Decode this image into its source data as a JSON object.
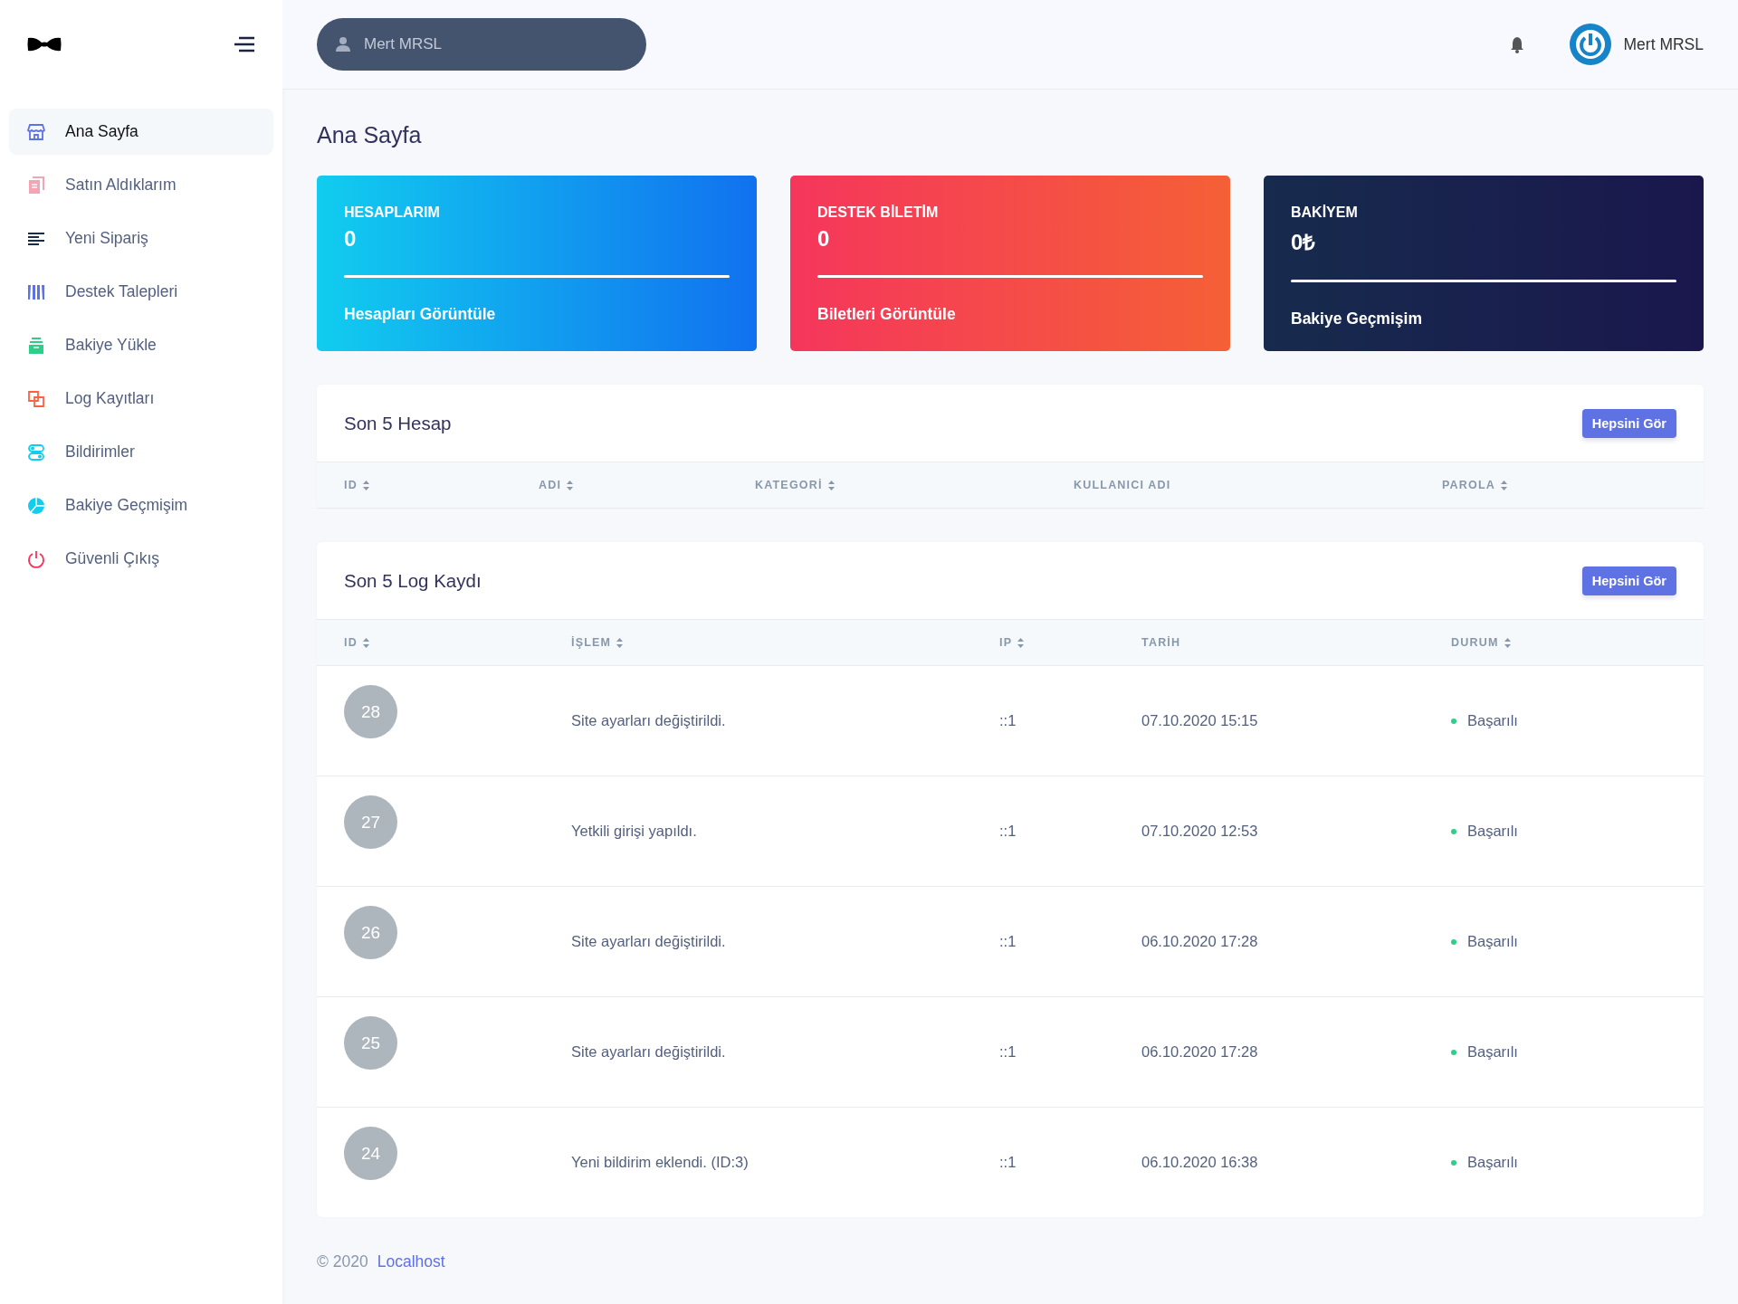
{
  "sidebar": {
    "items": [
      {
        "label": "Ana Sayfa",
        "kind": "store",
        "selected": true
      },
      {
        "label": "Satın Aldıklarım",
        "kind": "copies",
        "selected": false
      },
      {
        "label": "Yeni Sipariş",
        "kind": "lines",
        "selected": false
      },
      {
        "label": "Destek Talepleri",
        "kind": "bars",
        "selected": false
      },
      {
        "label": "Bakiye Yükle",
        "kind": "box",
        "selected": false
      },
      {
        "label": "Log Kayıtları",
        "kind": "squares",
        "selected": false
      },
      {
        "label": "Bildirimler",
        "kind": "toggles",
        "selected": false
      },
      {
        "label": "Bakiye Geçmişim",
        "kind": "pie",
        "selected": false
      },
      {
        "label": "Güvenli Çıkış",
        "kind": "power",
        "selected": false
      }
    ]
  },
  "header": {
    "search": {
      "placeholder": "Mert MRSL"
    },
    "user": {
      "name": "Mert MRSL"
    }
  },
  "page_title": "Ana Sayfa",
  "cards": [
    {
      "kind": "blue",
      "title": "HESAPLARIM",
      "value": "0",
      "link": "Hesapları Görüntüle"
    },
    {
      "kind": "red",
      "title": "DESTEK BİLETİM",
      "value": "0",
      "link": "Biletleri Görüntüle"
    },
    {
      "kind": "dark",
      "title": "BAKİYEM",
      "value": "0₺",
      "link": "Bakiye Geçmişim"
    }
  ],
  "accounts_table": {
    "title": "Son 5 Hesap",
    "button": "Hepsini Gör",
    "columns": [
      {
        "label": "ID",
        "sortable": true
      },
      {
        "label": "ADI",
        "sortable": true
      },
      {
        "label": "KATEGORİ",
        "sortable": true
      },
      {
        "label": "KULLANICI ADI",
        "sortable": false
      },
      {
        "label": "PAROLA",
        "sortable": true
      }
    ]
  },
  "log_table": {
    "title": "Son 5 Log Kaydı",
    "button": "Hepsini Gör",
    "columns": [
      {
        "label": "ID",
        "sortable": true
      },
      {
        "label": "İŞLEM",
        "sortable": true
      },
      {
        "label": "IP",
        "sortable": true
      },
      {
        "label": "TARİH",
        "sortable": false
      },
      {
        "label": "DURUM",
        "sortable": true
      }
    ],
    "rows": [
      {
        "id": "28",
        "action": "Site ayarları değiştirildi.",
        "ip": "::1",
        "date": "07.10.2020 15:15",
        "status": "Başarılı",
        "color": "#2dce89"
      },
      {
        "id": "27",
        "action": "Yetkili girişi yapıldı.",
        "ip": "::1",
        "date": "07.10.2020 12:53",
        "status": "Başarılı",
        "color": "#2dce89"
      },
      {
        "id": "26",
        "action": "Site ayarları değiştirildi.",
        "ip": "::1",
        "date": "06.10.2020 17:28",
        "status": "Başarılı",
        "color": "#2dce89"
      },
      {
        "id": "25",
        "action": "Site ayarları değiştirildi.",
        "ip": "::1",
        "date": "06.10.2020 17:28",
        "status": "Başarılı",
        "color": "#2dce89"
      },
      {
        "id": "24",
        "action": "Yeni bildirim eklendi. (ID:3)",
        "ip": "::1",
        "date": "06.10.2020 16:38",
        "status": "Başarılı",
        "color": "#2dce89"
      }
    ]
  },
  "footer": {
    "copyright": "© 2020",
    "link": "Localhost"
  }
}
